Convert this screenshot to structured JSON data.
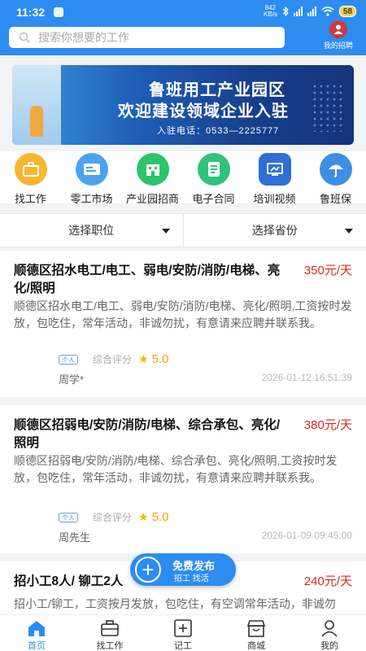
{
  "status": {
    "time": "11:32",
    "net_speed": "842",
    "net_unit": "KB/s",
    "battery": "58"
  },
  "header": {
    "search_placeholder": "搜索你想要的工作",
    "my_recruit_label": "我的招聘"
  },
  "banner": {
    "title_line1": "鲁班用工产业园区",
    "title_line2": "欢迎建设领域企业入驻",
    "phone_line": "入驻电话：0533—2225777"
  },
  "categories": [
    {
      "label": "找工作",
      "icon": "briefcase-icon",
      "color": "#f7b731"
    },
    {
      "label": "零工市场",
      "icon": "card-icon",
      "color": "#4aa3f0"
    },
    {
      "label": "产业园招商",
      "icon": "building-icon",
      "color": "#2cc36b"
    },
    {
      "label": "电子合同",
      "icon": "contract-icon",
      "color": "#31c27c"
    },
    {
      "label": "培训视频",
      "icon": "video-icon",
      "color": "#2f6fd6"
    },
    {
      "label": "鲁班保",
      "icon": "umbrella-icon",
      "color": "#3d8fe6"
    }
  ],
  "filters": {
    "position": "选择职位",
    "province": "选择省份"
  },
  "jobs": [
    {
      "title": "顺德区招水电工/电工、弱电/安防/消防/电梯、亮化/照明",
      "price": "350元/天",
      "desc": "顺德区招水电工/电工、弱电/安防/消防/电梯、亮化/照明,工资按时发放，包吃住，常年活动，非诚勿扰，有意请来应聘并联系我。",
      "badge": "个人",
      "rating_label": "综合评分",
      "score": "5.0",
      "poster": "周学*",
      "date": "2026-01-12 16:51:39"
    },
    {
      "title": "顺德区招弱电/安防/消防/电梯、综合承包、亮化/照明",
      "price": "380元/天",
      "desc": "顺德区招弱电/安防/消防/电梯、综合承包、亮化/照明,工资按时发放，包吃住，常年活动，非诚勿扰，有意请来应聘并联系我。",
      "badge": "个人",
      "rating_label": "综合评分",
      "score": "5.0",
      "poster": "周先生",
      "date": "2026-01-09 09:45:00"
    },
    {
      "title": "招小工8人/ 铆工2人",
      "price": "240元/天",
      "desc": "招小工/铆工，工资按月发放，包吃住，有空调常年活动，非诚勿扰，有意请来应聘并联系我。"
    }
  ],
  "fab": {
    "line1": "免费发布",
    "line2": "招工 找活"
  },
  "tabs": [
    {
      "label": "首页",
      "icon": "home-icon"
    },
    {
      "label": "找工作",
      "icon": "briefcase-icon"
    },
    {
      "label": "记工",
      "icon": "record-icon"
    },
    {
      "label": "商城",
      "icon": "shop-icon"
    },
    {
      "label": "我的",
      "icon": "user-icon"
    }
  ]
}
